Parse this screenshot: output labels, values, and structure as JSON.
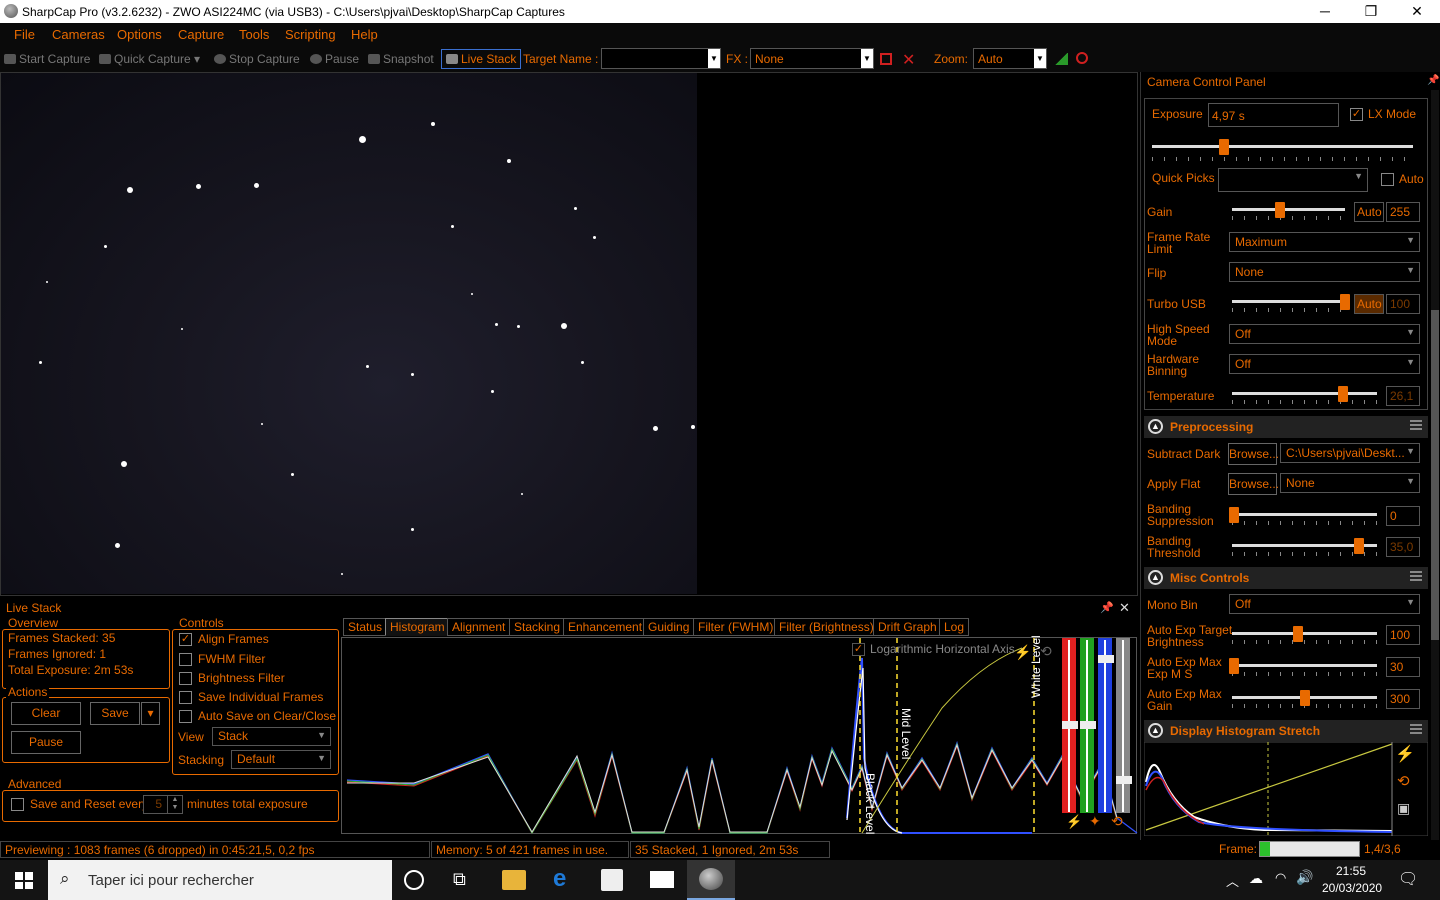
{
  "window": {
    "title": "SharpCap Pro (v3.2.6232) - ZWO ASI224MC (via USB3) - C:\\Users\\pjvai\\Desktop\\SharpCap Captures",
    "minimize": "─",
    "maximize": "❐",
    "close": "✕"
  },
  "menu": [
    "File",
    "Cameras",
    "Options",
    "Capture",
    "Tools",
    "Scripting",
    "Help"
  ],
  "toolbar": {
    "start_capture": "Start Capture",
    "quick_capture": "Quick Capture",
    "stop_capture": "Stop Capture",
    "pause": "Pause",
    "snapshot": "Snapshot",
    "live_stack": "Live Stack",
    "target_name_label": "Target Name :",
    "target_name_value": "",
    "fx_label": "FX :",
    "fx_value": "None",
    "zoom_label": "Zoom:",
    "zoom_value": "Auto"
  },
  "camera_panel": {
    "title": "Camera Control Panel",
    "exposure_label": "Exposure",
    "exposure_value": "4,97 s",
    "lx_mode_label": "LX Mode",
    "lx_mode_checked": true,
    "quick_picks_label": "Quick Picks",
    "quick_picks_value": "",
    "quick_auto_label": "Auto",
    "gain_label": "Gain",
    "gain_auto": "Auto",
    "gain_value": "255",
    "frame_rate_label": "Frame Rate Limit",
    "frame_rate_value": "Maximum",
    "flip_label": "Flip",
    "flip_value": "None",
    "turbo_label": "Turbo USB",
    "turbo_auto": "Auto",
    "turbo_value": "100",
    "high_speed_label": "High Speed Mode",
    "high_speed_value": "Off",
    "binning_label": "Hardware Binning",
    "binning_value": "Off",
    "temperature_label": "Temperature",
    "temperature_value": "26,1",
    "preprocessing_title": "Preprocessing",
    "subtract_dark_label": "Subtract Dark",
    "browse1": "Browse...",
    "subtract_dark_value": "C:\\Users\\pjvai\\Deskt...",
    "apply_flat_label": "Apply Flat",
    "browse2": "Browse...",
    "apply_flat_value": "None",
    "banding_supp_label": "Banding Suppression",
    "banding_supp_value": "0",
    "banding_thr_label": "Banding Threshold",
    "banding_thr_value": "35,0",
    "misc_title": "Misc Controls",
    "mono_bin_label": "Mono Bin",
    "mono_bin_value": "Off",
    "ae_target_label": "Auto Exp Target Brightness",
    "ae_target_value": "100",
    "ae_maxexp_label": "Auto Exp Max Exp M S",
    "ae_maxexp_value": "30",
    "ae_maxgain_label": "Auto Exp Max Gain",
    "ae_maxgain_value": "300",
    "dhs_title": "Display Histogram Stretch"
  },
  "live_stack": {
    "title": "Live Stack",
    "overview_title": "Overview",
    "frames_stacked": "Frames Stacked: 35",
    "frames_ignored": "Frames Ignored:  1",
    "total_exposure": "Total Exposure:   2m 53s",
    "actions_title": "Actions",
    "clear": "Clear",
    "save": "Save",
    "pause": "Pause",
    "advanced_title": "Advanced",
    "save_reset_label": "Save and Reset every",
    "save_reset_value": "5",
    "minutes_label": "minutes total exposure",
    "controls_title": "Controls",
    "align_frames": "Align Frames",
    "fwhm_filter": "FWHM Filter",
    "brightness_filter": "Brightness Filter",
    "save_individual": "Save Individual Frames",
    "auto_save": "Auto Save on Clear/Close",
    "view_label": "View",
    "view_value": "Stack",
    "stacking_label": "Stacking",
    "stacking_value": "Default",
    "tabs": [
      "Status",
      "Histogram",
      "Alignment",
      "Stacking",
      "Enhancement",
      "Guiding",
      "Filter (FWHM)",
      "Filter (Brightness)",
      "Drift Graph",
      "Log"
    ],
    "active_tab": "Histogram",
    "log_axis_label": "Logarithmic Horizontal Axis",
    "black_level": "Black Level",
    "mid_level": "Mid Level",
    "white_level": "White Level"
  },
  "status": {
    "previewing": "Previewing : 1083 frames (6 dropped) in 0:45:21,5, 0,2 fps",
    "memory": "Memory: 5 of 421 frames in use.",
    "stacked": "35 Stacked, 1 Ignored, 2m 53s",
    "frame_label": "Frame:",
    "frame_value": "1,4/3,6",
    "frame_progress": 0.1
  },
  "taskbar": {
    "search_placeholder": "Taper ici pour rechercher",
    "time": "21:55",
    "date": "20/03/2020"
  }
}
